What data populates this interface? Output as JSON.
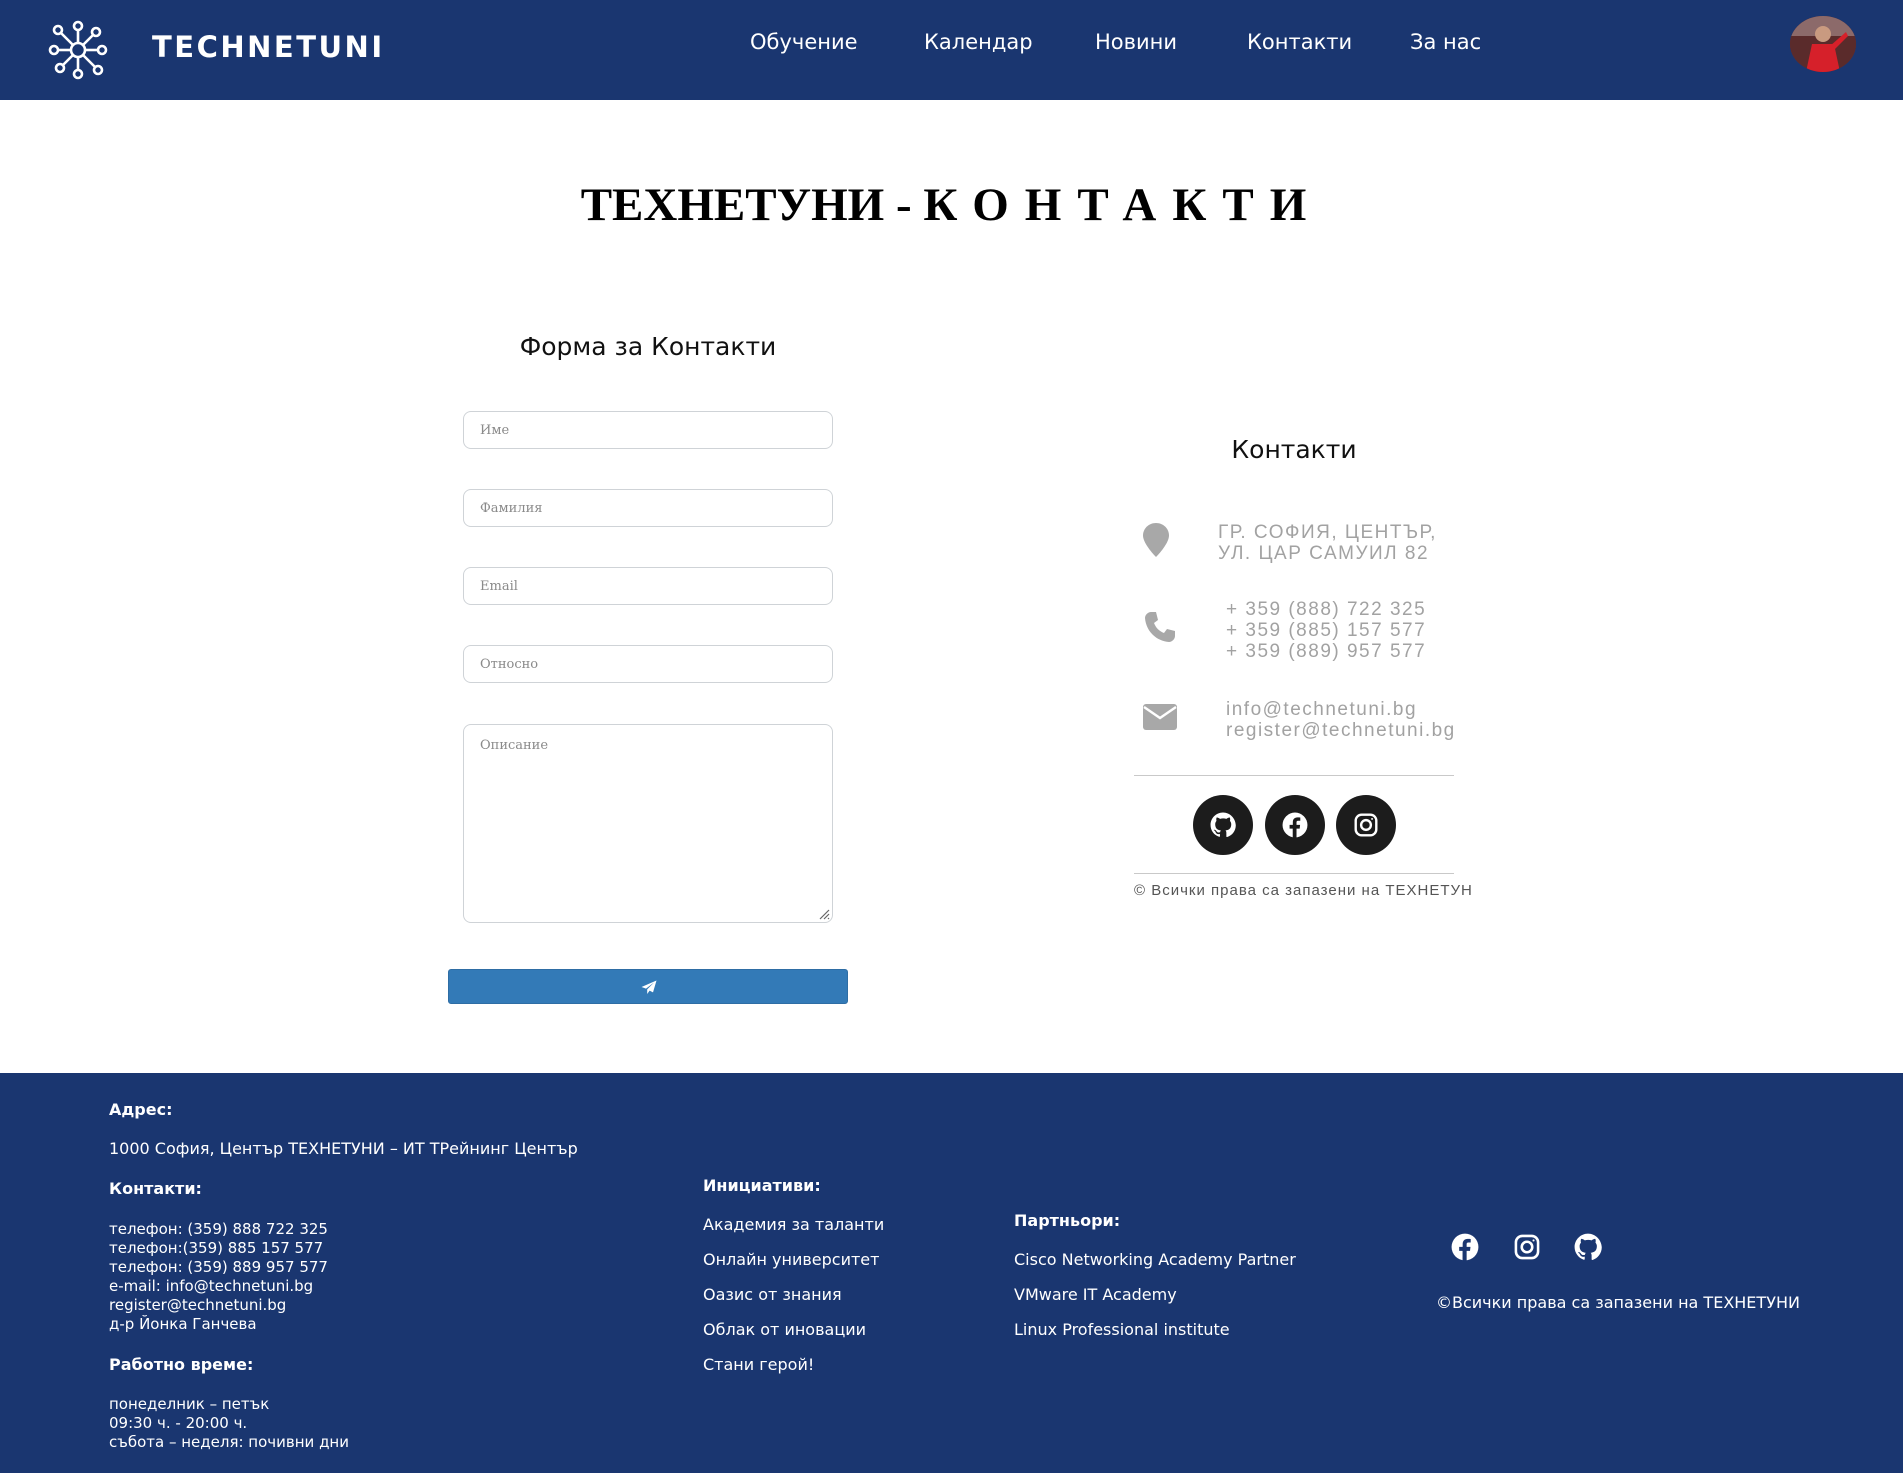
{
  "header": {
    "brand": "TECHNETUNI",
    "nav": [
      "Обучение",
      "Календар",
      "Новини",
      "Контакти",
      "За нас"
    ]
  },
  "main": {
    "title_main": "ТЕХНЕТУНИ -",
    "title_spaced": "КОНТАКТИ",
    "form": {
      "title": "Форма за Контакти",
      "placeholders": {
        "first_name": "Име",
        "last_name": "Фамилия",
        "email": "Email",
        "subject": "Относно",
        "description": "Описание"
      },
      "send_icon": "paper-plane-icon"
    },
    "contacts": {
      "title": "Контакти",
      "address_line1": "ГР. СОФИЯ, ЦЕНТЪР,",
      "address_line2": "УЛ. ЦАР САМУИЛ 82",
      "phone1": "+ 359 (888) 722 325",
      "phone2": "+ 359 (885) 157 577",
      "phone3": "+ 359 (889) 957 577",
      "email1": "info@technetuni.bg",
      "email2": "register@technetuni.bg",
      "socials": [
        "github-icon",
        "facebook-icon",
        "instagram-icon"
      ],
      "rights": "© Всички права са запазени на ТЕХНЕТУН"
    }
  },
  "footer": {
    "address_head": "Адрес:",
    "address_text": "1000 София, Център ТЕХНЕТУНИ – ИТ ТРейнинг Център",
    "contacts_head": "Контакти:",
    "contact_lines": [
      "телефон: (359) 888 722 325",
      "телефон:(359) 885 157 577",
      "телефон: (359) 889 957 577",
      "e-mail: info@technetuni.bg",
      "register@technetuni.bg",
      "д-р Йонка Ганчева"
    ],
    "hours_head": "Работно време:",
    "hours_lines": [
      "понеделник – петък",
      "09:30 ч. - 20:00 ч.",
      "събота – неделя: почивни дни"
    ],
    "initiatives_head": "Инициативи:",
    "initiatives": [
      "Академия за таланти",
      "Онлайн университет",
      "Оазис от знания",
      "Облак от иновации",
      "Стани герой!"
    ],
    "partners_head": "Партньори:",
    "partners": [
      "Cisco Networking Academy Partner",
      "VMware IT Academy",
      "Linux Professional institute"
    ],
    "socials": [
      "facebook-icon",
      "instagram-icon",
      "github-icon"
    ],
    "rights": "©Всички права са запазени на ТЕХНЕТУНИ"
  },
  "colors": {
    "header_bg": "#1a3670",
    "footer_bg": "#1a3670",
    "button_bg": "#337ab7",
    "muted_text": "#a2a2a2"
  }
}
